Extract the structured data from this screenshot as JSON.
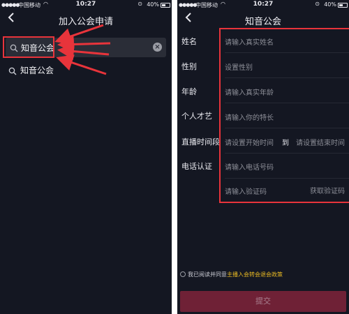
{
  "status_bar": {
    "carrier": "中国移动",
    "time": "10:27",
    "battery": "40%"
  },
  "left_screen": {
    "title": "加入公会申请",
    "search_query": "知音公会",
    "result_label": "知音公会"
  },
  "right_screen": {
    "title": "知音公会",
    "fields": [
      {
        "label": "姓名",
        "placeholder": "请输入真实姓名"
      },
      {
        "label": "性别",
        "placeholder": "设置性别"
      },
      {
        "label": "年龄",
        "placeholder": "请输入真实年龄"
      },
      {
        "label": "个人才艺",
        "placeholder": "请输入你的特长"
      },
      {
        "label": "直播时间段",
        "placeholder_start": "请设置开始时间",
        "to": "到",
        "placeholder_end": "请设置结束时间"
      },
      {
        "label": "电话认证",
        "placeholder": "请输入电话号码"
      },
      {
        "label": "",
        "placeholder": "请输入验证码",
        "action": "获取验证码"
      }
    ],
    "agree_prefix": "我已阅读并同意",
    "agree_link": "主播入会转会退会政策",
    "submit_label": "提交"
  },
  "icons": {
    "back": "chevron-left-icon",
    "search": "search-icon",
    "clear": "clear-icon",
    "wifi": "wifi-icon",
    "lock": "rotation-lock-icon",
    "battery": "battery-icon"
  },
  "colors": {
    "background": "#141722",
    "highlight": "#e8343b",
    "submit": "#6f2136",
    "link": "#e8b923"
  }
}
